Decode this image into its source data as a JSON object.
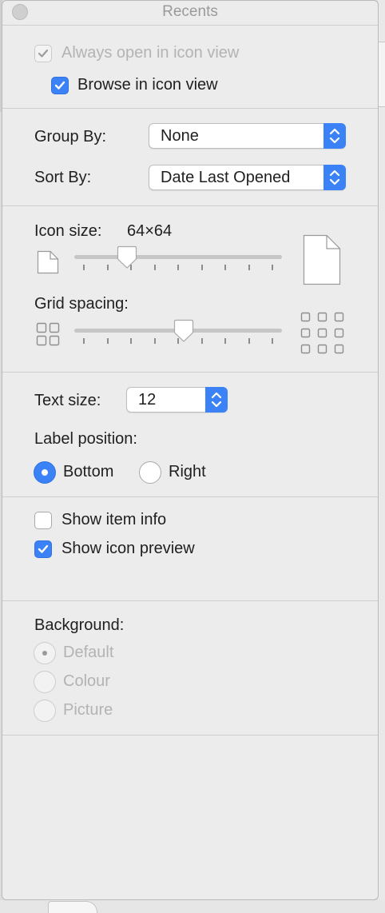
{
  "window": {
    "title": "Recents"
  },
  "icon_view": {
    "always_open_label": "Always open in icon view",
    "always_open_checked": true,
    "browse_label": "Browse in icon view",
    "browse_checked": true
  },
  "grouping": {
    "group_by_label": "Group By:",
    "group_by_value": "None",
    "sort_by_label": "Sort By:",
    "sort_by_value": "Date Last Opened"
  },
  "icon_size": {
    "label": "Icon size:",
    "value": "64×64",
    "slider_fraction": 0.23
  },
  "grid_spacing": {
    "label": "Grid spacing:",
    "slider_fraction": 0.53
  },
  "text": {
    "text_size_label": "Text size:",
    "text_size_value": "12",
    "label_position_label": "Label position:",
    "bottom_label": "Bottom",
    "right_label": "Right",
    "selected": "Bottom"
  },
  "info": {
    "show_item_info_label": "Show item info",
    "show_item_info_checked": false,
    "show_icon_preview_label": "Show icon preview",
    "show_icon_preview_checked": true
  },
  "background": {
    "label": "Background:",
    "options": [
      "Default",
      "Colour",
      "Picture"
    ],
    "selected": "Default"
  },
  "colors": {
    "accent": "#3b82f6",
    "panel_bg": "#ececec",
    "disabled_text": "#b3b3b3"
  }
}
